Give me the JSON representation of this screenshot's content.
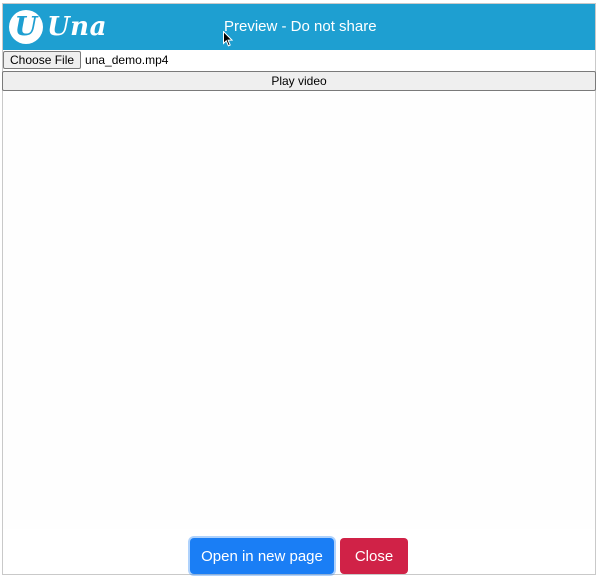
{
  "header": {
    "logo_mark": "U",
    "logo_text": "Una",
    "title": "Preview - Do not share",
    "background_color": "#1e9fd1"
  },
  "file_input": {
    "button_label": "Choose File",
    "file_name": "una_demo.mp4"
  },
  "player": {
    "play_label": "Play video"
  },
  "footer": {
    "open_label": "Open in new page",
    "close_label": "Close",
    "open_color": "#1a7ef5",
    "close_color": "#d02247"
  },
  "icons": {
    "cursor": "mouse-cursor-icon"
  }
}
